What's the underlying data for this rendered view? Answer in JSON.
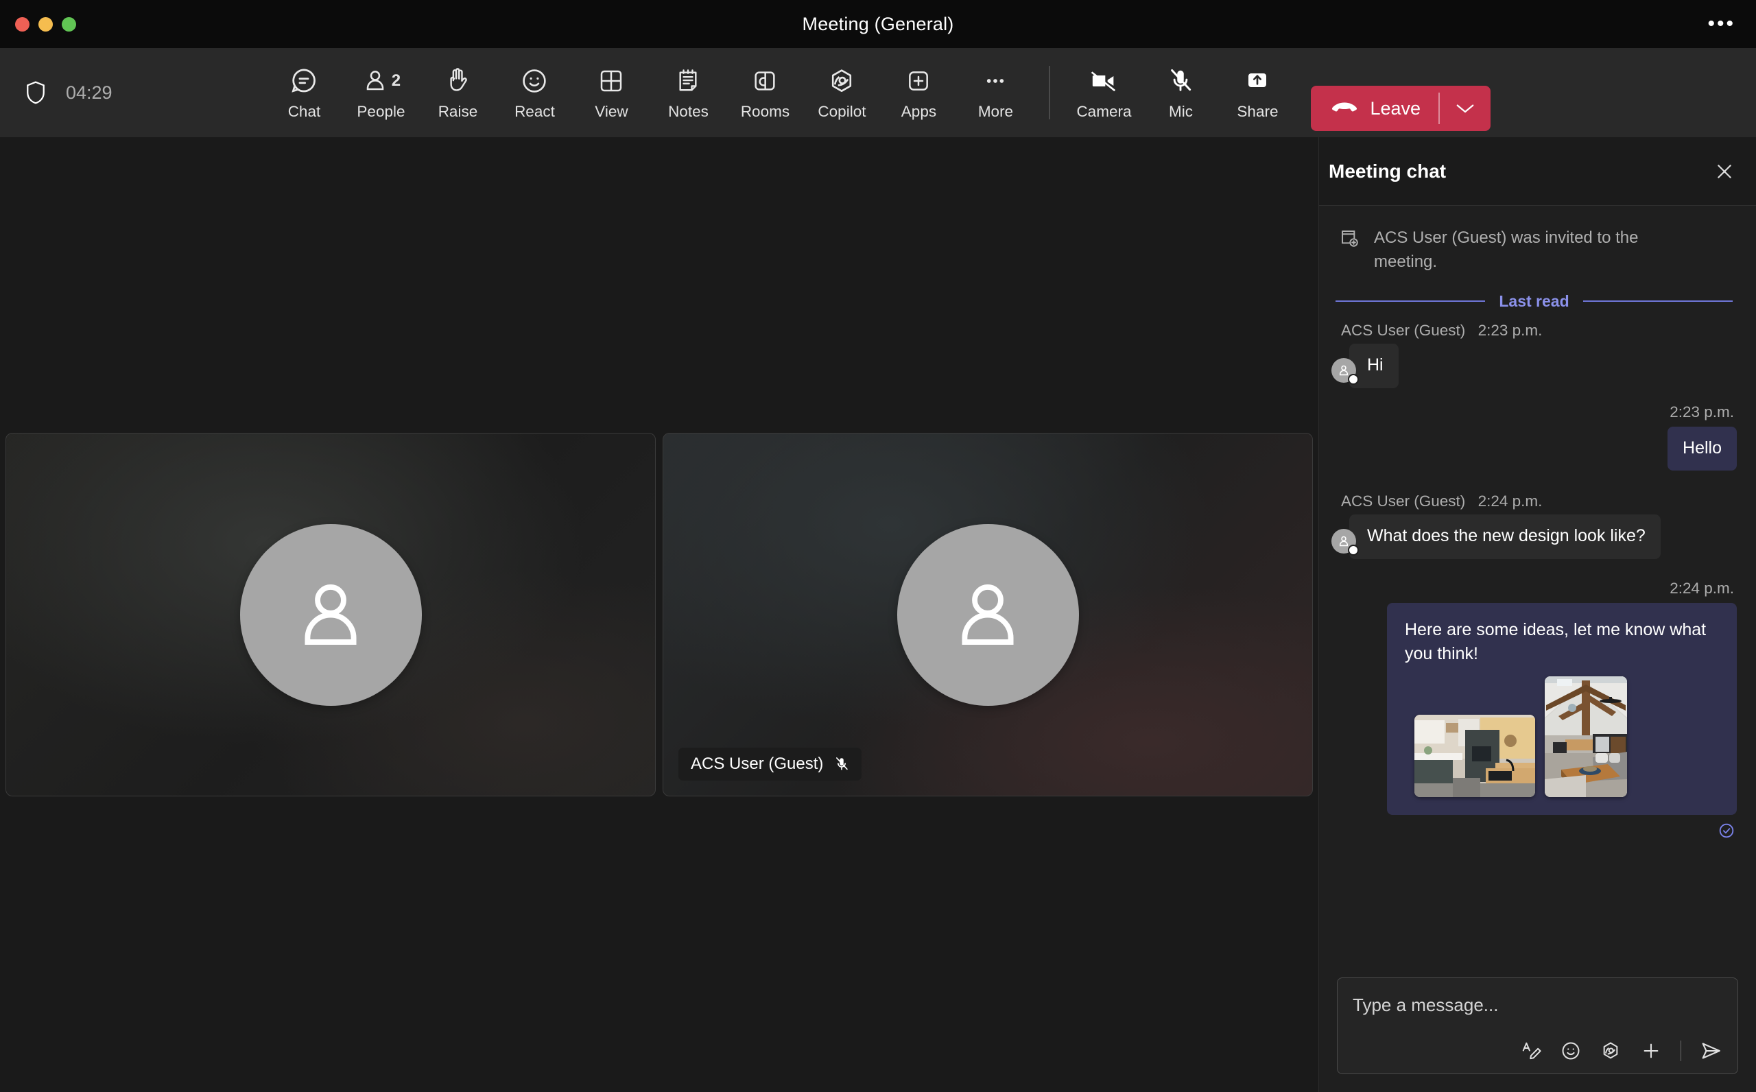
{
  "window": {
    "title": "Meeting (General)",
    "more_icon": "ellipsis-icon"
  },
  "toolbar": {
    "shield_icon": "shield-icon",
    "timer": "04:29",
    "items": [
      {
        "label": "Chat",
        "icon": "chat-icon",
        "active": true
      },
      {
        "label": "People",
        "icon": "people-icon",
        "badge": "2"
      },
      {
        "label": "Raise",
        "icon": "raise-hand-icon"
      },
      {
        "label": "React",
        "icon": "react-smiley-icon"
      },
      {
        "label": "View",
        "icon": "view-grid-icon"
      },
      {
        "label": "Notes",
        "icon": "notes-icon"
      },
      {
        "label": "Rooms",
        "icon": "rooms-icon"
      },
      {
        "label": "Copilot",
        "icon": "copilot-icon"
      },
      {
        "label": "Apps",
        "icon": "apps-plus-icon"
      },
      {
        "label": "More",
        "icon": "more-ellipsis-icon"
      }
    ],
    "media": [
      {
        "label": "Camera",
        "icon": "camera-off-icon",
        "state": "off"
      },
      {
        "label": "Mic",
        "icon": "mic-muted-icon",
        "state": "muted"
      },
      {
        "label": "Share",
        "icon": "share-screen-icon",
        "state": "on"
      }
    ],
    "leave": {
      "label": "Leave",
      "icon": "call-end-icon",
      "caret_icon": "chevron-down-icon",
      "color": "#c4314b"
    },
    "active_indicator_color": "#7b83eb"
  },
  "stage": {
    "tiles": [
      {
        "name": "",
        "avatar_icon": "person-avatar-icon",
        "muted": false,
        "show_label": false
      },
      {
        "name": "ACS User (Guest)",
        "avatar_icon": "person-avatar-icon",
        "muted": true,
        "show_label": true,
        "mic_icon": "mic-muted-icon"
      }
    ]
  },
  "chat": {
    "title": "Meeting chat",
    "close_icon": "close-icon",
    "system_message": {
      "icon": "calendar-add-icon",
      "text": "ACS User (Guest) was invited to the meeting."
    },
    "last_read_label": "Last read",
    "last_read_color": "#7b83eb",
    "messages": [
      {
        "side": "in",
        "author": "ACS User (Guest)",
        "time": "2:23 p.m.",
        "text": "Hi",
        "avatar_icon": "person-avatar-icon"
      },
      {
        "side": "out",
        "time": "2:23 p.m.",
        "text": "Hello"
      },
      {
        "side": "in",
        "author": "ACS User (Guest)",
        "time": "2:24 p.m.",
        "text": "What does the new design look like?",
        "avatar_icon": "person-avatar-icon"
      },
      {
        "side": "out",
        "time": "2:24 p.m.",
        "text": "Here are some ideas, let me know what you think!",
        "attachments": [
          {
            "alt": "modern kitchen interior photo"
          },
          {
            "alt": "vaulted ceiling living room photo"
          }
        ],
        "receipt_icon": "read-receipt-check-icon"
      }
    ],
    "composer": {
      "placeholder": "Type a message...",
      "tools": [
        {
          "icon": "format-text-icon"
        },
        {
          "icon": "emoji-icon"
        },
        {
          "icon": "copilot-icon"
        },
        {
          "icon": "attach-plus-icon"
        },
        {
          "icon": "send-icon"
        }
      ]
    }
  }
}
